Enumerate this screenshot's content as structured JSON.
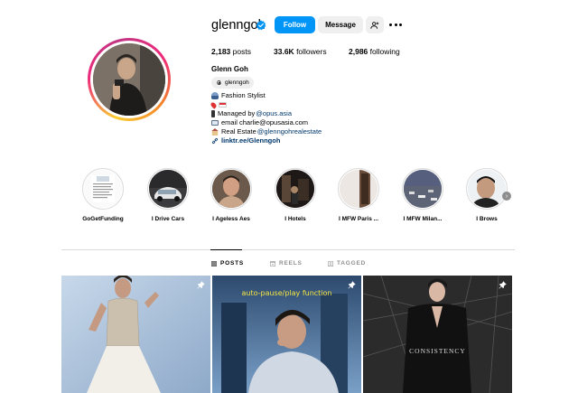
{
  "profile": {
    "username": "glenngoh",
    "verified": true,
    "follow_label": "Follow",
    "message_label": "Message",
    "stats": [
      {
        "count": "2,183",
        "label": "posts"
      },
      {
        "count": "33.6K",
        "label": "followers"
      },
      {
        "count": "2,986",
        "label": "following"
      }
    ],
    "full_name": "Glenn Goh",
    "threads_handle": "glenngoh",
    "bio": {
      "line1": "Fashion Stylist",
      "managed_prefix": "Managed by ",
      "managed_link": "@opus.asia",
      "email": "email charlie@opusasia.com",
      "realestate_prefix": "Real Estate ",
      "realestate_link": "@glenngohrealestate",
      "website": "linktr.ee/Glenngoh"
    }
  },
  "highlights": [
    {
      "label": "GoGetFunding"
    },
    {
      "label": "I Drive Cars"
    },
    {
      "label": "I Ageless Aes"
    },
    {
      "label": "I Hotels"
    },
    {
      "label": "I MFW Paris ..."
    },
    {
      "label": "I MFW Milan..."
    },
    {
      "label": "I Brows"
    }
  ],
  "tabs": [
    {
      "label": "POSTS",
      "active": true
    },
    {
      "label": "REELS",
      "active": false
    },
    {
      "label": "TAGGED",
      "active": false
    }
  ],
  "posts": [
    {
      "caption": ""
    },
    {
      "caption": "auto-pause/play function"
    },
    {
      "caption": "CONSISTENCY"
    }
  ],
  "colors": {
    "accent": "#0095f6",
    "verified": "#0095f6",
    "link": "#00376b",
    "button_gray": "#efefef",
    "divider": "#dbdbdb"
  },
  "icons": [
    "verified-icon",
    "add-person-icon",
    "more-icon",
    "threads-icon",
    "grid-icon",
    "reels-icon",
    "tagged-icon",
    "pin-icon",
    "chevron-right-icon"
  ]
}
